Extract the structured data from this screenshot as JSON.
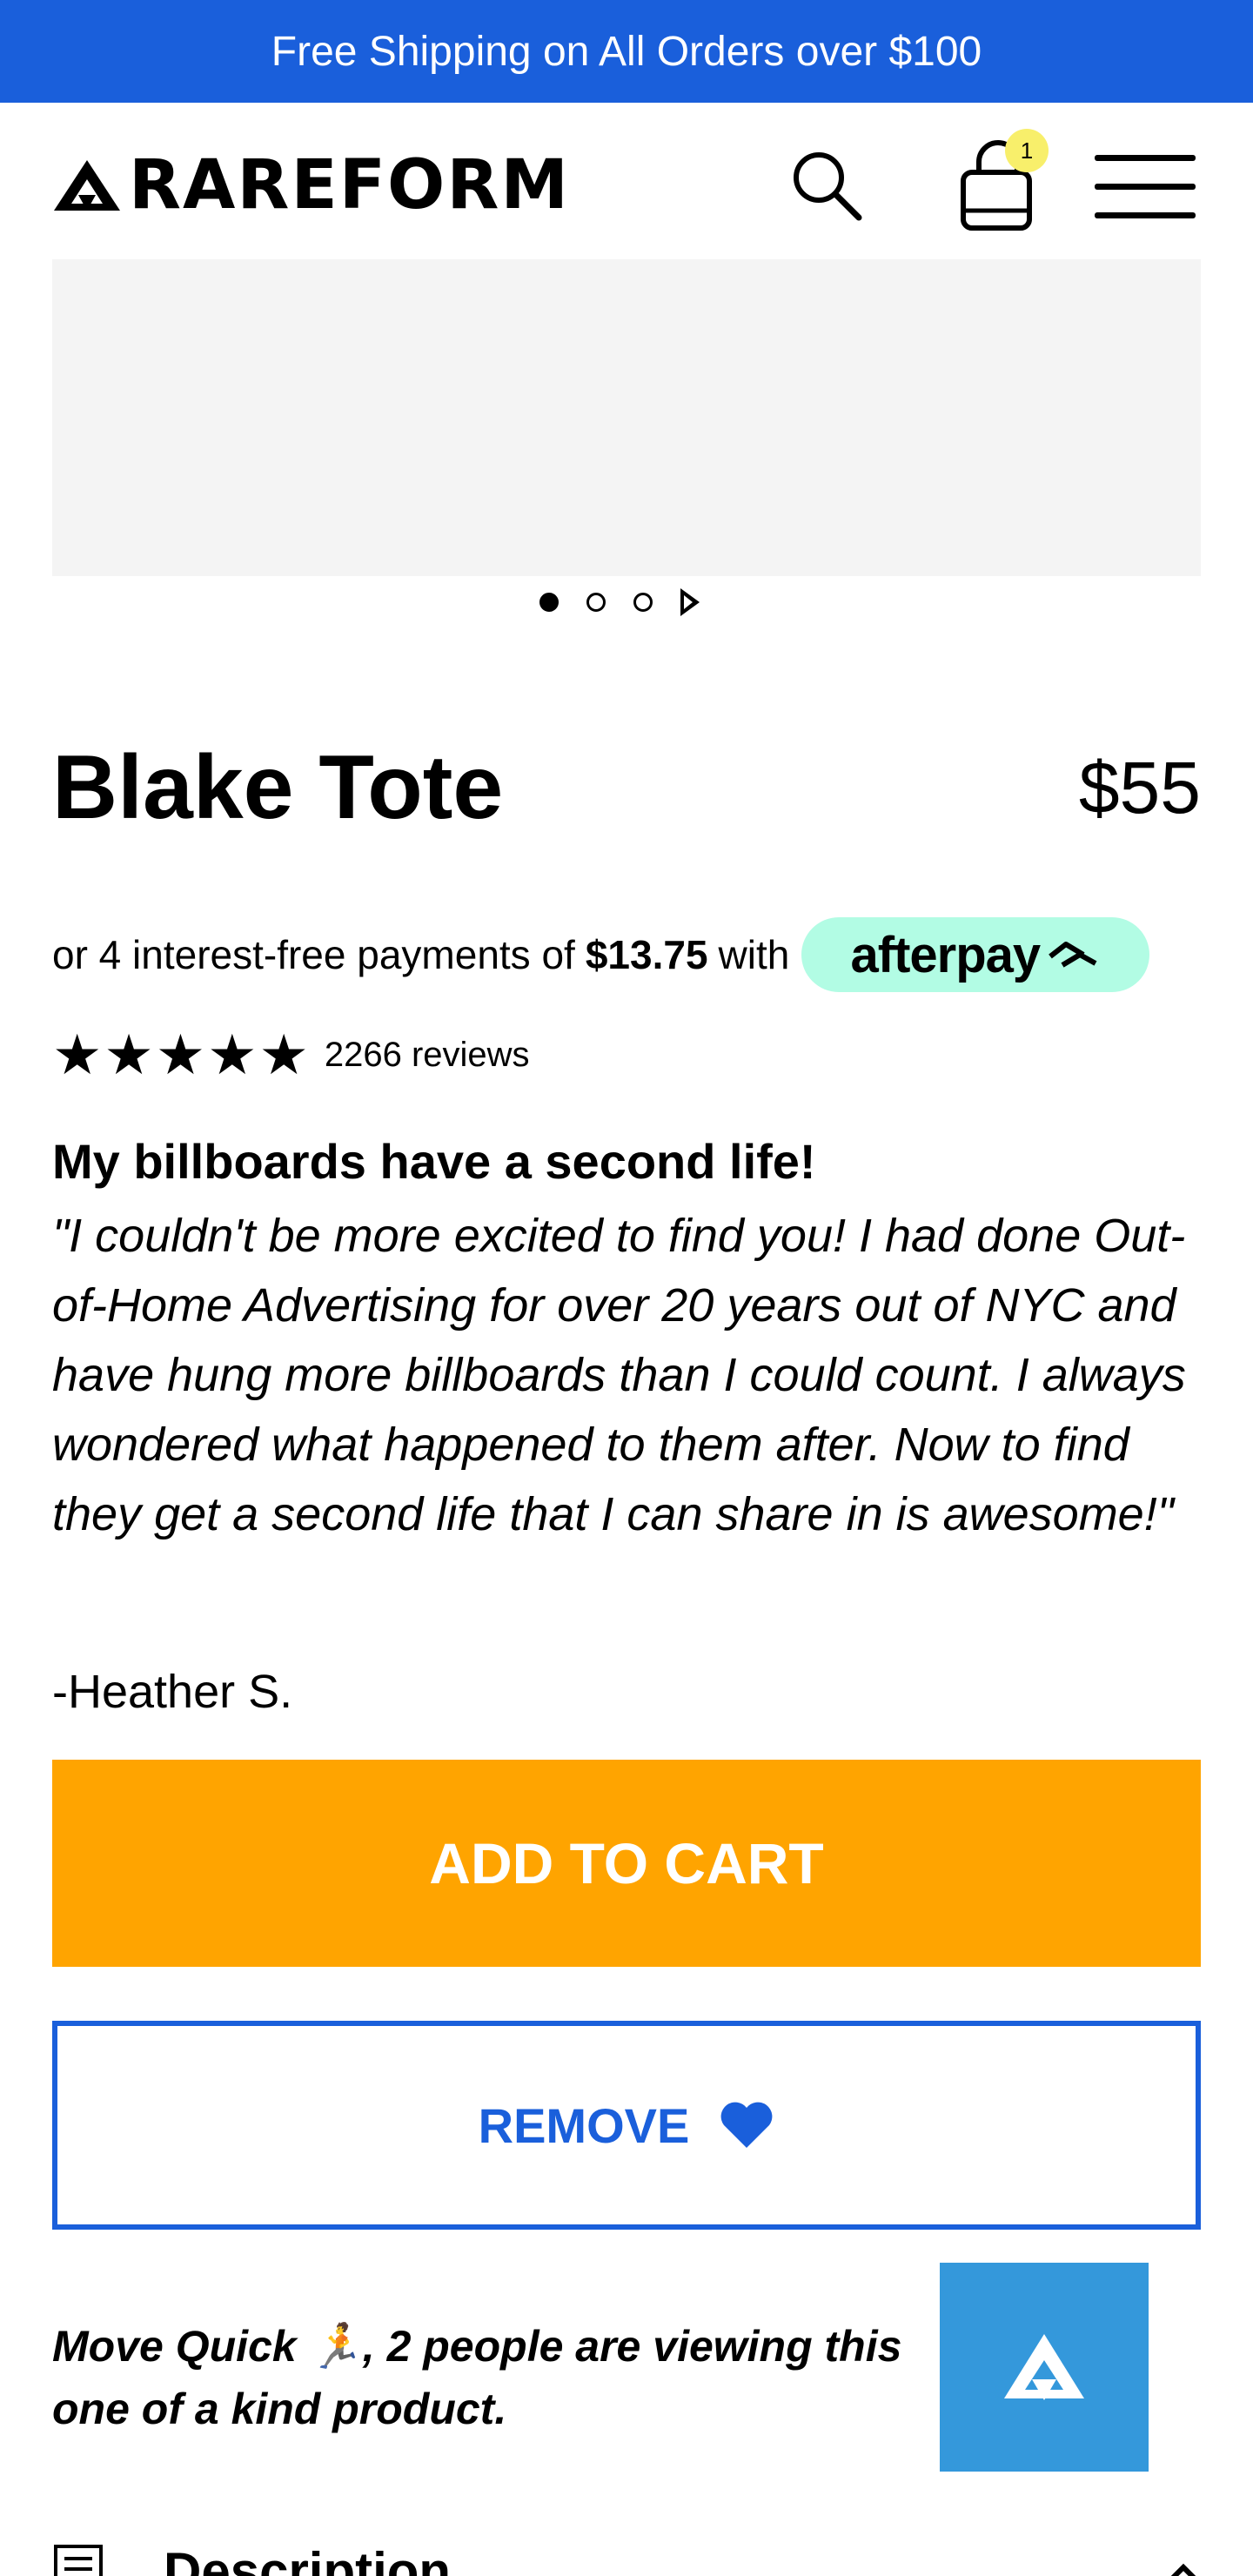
{
  "banner": {
    "text": "Free Shipping on All Orders over $100"
  },
  "header": {
    "brand": "RAREFORM",
    "cart_count": "1",
    "icons": {
      "logo": "rareform-mark-icon",
      "search": "search-icon",
      "cart": "shopping-bag-icon",
      "menu": "hamburger-menu-icon"
    }
  },
  "gallery": {
    "slides": 3,
    "active_slide": 1
  },
  "product": {
    "title": "Blake Tote",
    "price": "$55",
    "afterpay": {
      "prefix": "or 4 interest-free payments of",
      "amount": "$13.75",
      "suffix": "with",
      "brand": "afterpay",
      "color": "#b2fce4"
    },
    "rating": {
      "stars": 5,
      "stars_text": "★★★★★",
      "review_count": "2266 reviews"
    }
  },
  "testimonial": {
    "title": "My billboards have a second life!",
    "quote": "\"I couldn't be more excited to find you! I had done Out-of-Home Advertising for over 20 years out of NYC and have hung more billboards than I could count. I always wondered what happened to them after. Now to find they get a second life that I can share in is awesome!\"",
    "author": "-Heather S."
  },
  "actions": {
    "add_to_cart": "ADD TO CART",
    "remove": "REMOVE",
    "add_color": "#ffa400",
    "remove_color": "#1a5fdb"
  },
  "urgency": {
    "text": "Move Quick 🏃, 2 people are viewing this one of a kind product."
  },
  "description": {
    "label": "Description"
  },
  "colors": {
    "banner": "#1a5fdb",
    "float_button": "#3498db"
  }
}
